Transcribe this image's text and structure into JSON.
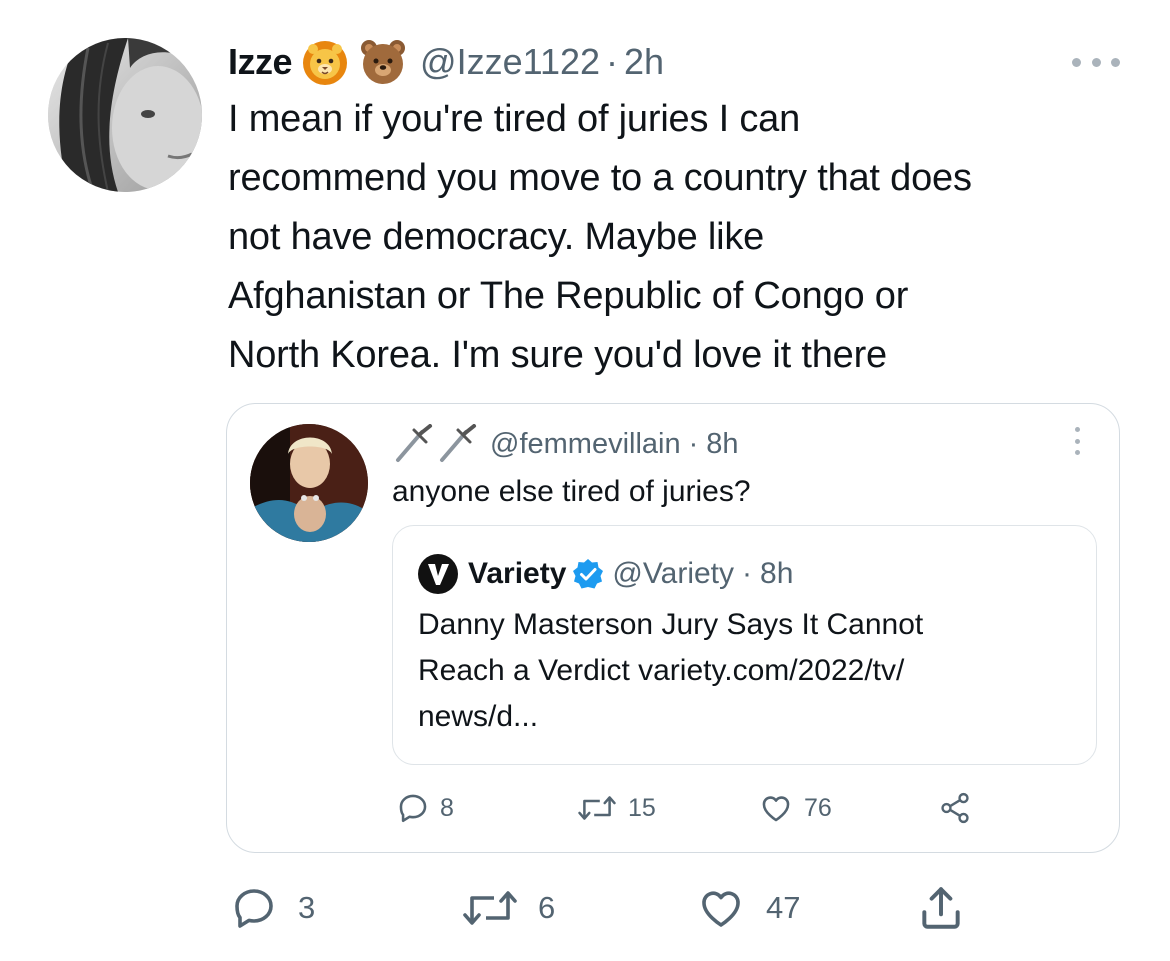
{
  "tweet": {
    "author_name": "Izze",
    "emoji_1": "lion-face-emoji",
    "emoji_2": "bear-face-emoji",
    "handle": "@Izze1122",
    "separator": "·",
    "time": "2h",
    "text": "I mean if you're tired of juries I can\nrecommend you move to a country that does\nnot have democracy. Maybe like\nAfghanistan or The Republic of Congo or\nNorth Korea. I'm sure you'd love it there",
    "more_icon": "more-horizontal-icon",
    "actions": {
      "replies": "3",
      "retweets": "6",
      "likes": "47"
    }
  },
  "quoted_tweet": {
    "name_emoji": "dagger-dagger-emoji",
    "handle": "@femmevillain",
    "separator": "·",
    "time": "8h",
    "text": "anyone else tired of juries?",
    "more_icon": "more-vertical-icon",
    "actions": {
      "replies": "8",
      "retweets": "15",
      "likes": "76"
    },
    "nested_tweet": {
      "author_name": "Variety",
      "verified": true,
      "handle": "@Variety",
      "separator": "·",
      "time": "8h",
      "text": "Danny Masterson Jury Says It Cannot\nReach a Verdict variety.com/2022/tv/\nnews/d..."
    }
  },
  "colors": {
    "text": "#0f1419",
    "secondary": "#536471",
    "border": "#d4dbe1",
    "verified": "#1d9bf0"
  }
}
